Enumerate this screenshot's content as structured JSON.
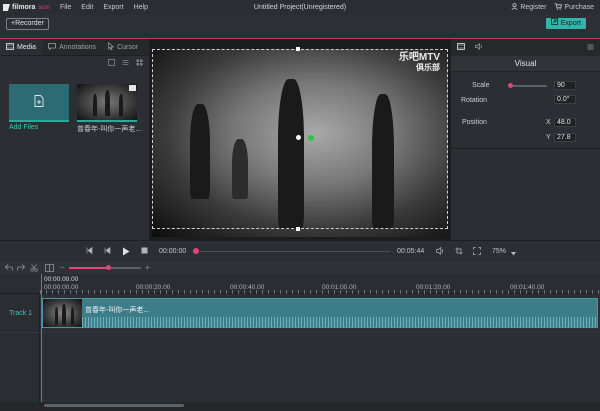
{
  "app": {
    "logo_text": "filmora",
    "logo_sub": "scrn",
    "window_title": "Untitled Project(Unregistered)"
  },
  "menu": [
    "File",
    "Edit",
    "Export",
    "Help"
  ],
  "title_actions": {
    "register": "Register",
    "purchase": "Purchase"
  },
  "toolbar": {
    "recorder_label": "+Recorder",
    "export_label": "Export"
  },
  "left_panel": {
    "tabs": [
      "Media",
      "Annotations",
      "Cursor"
    ],
    "items": [
      {
        "label": "Add Files",
        "type": "add"
      },
      {
        "label": "曾春年-叫你一声老...",
        "type": "clip"
      }
    ]
  },
  "preview": {
    "watermark_line1": "乐吧MTV",
    "watermark_line2": "俱乐部"
  },
  "right_panel": {
    "title": "Visual",
    "scale_label": "Scale",
    "scale_value": "90",
    "rotation_label": "Rotation",
    "rotation_value": "0.0°",
    "position_label": "Position",
    "x_label": "X",
    "x_value": "48.0",
    "y_label": "Y",
    "y_value": "27.8"
  },
  "transport": {
    "current_time": "00:00:00",
    "total_time": "00:05:44",
    "zoom": "75%"
  },
  "timeline": {
    "current_time": "00:00:00.00",
    "ruler": [
      "00:00:00.00",
      "00:00:20.00",
      "00:00:40.00",
      "00:01:00.00",
      "00:01:20.00",
      "00:01:40.00"
    ],
    "track_label": "Track 1",
    "clip_title": "曾春年-叫你一声老..."
  },
  "colors": {
    "accent": "#e0457b",
    "teal": "#2fb6a8",
    "bg": "#2b2f33"
  }
}
